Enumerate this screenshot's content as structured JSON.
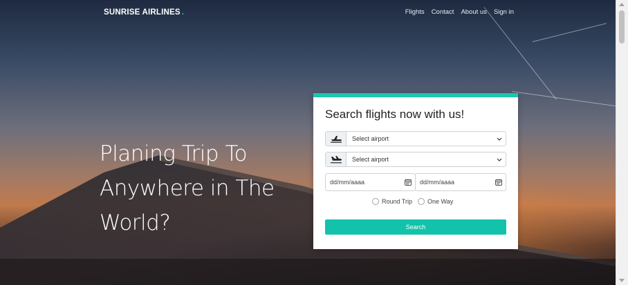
{
  "nav": {
    "brand": "SUNRISE AIRLINES",
    "brand_dot": ".",
    "links": [
      "Flights",
      "Contact",
      "About us",
      "Sign in"
    ]
  },
  "hero": {
    "headline_lines": [
      "Planing Trip To",
      "Anywhere in The",
      "World?"
    ]
  },
  "search_card": {
    "title": "Search flights now with us!",
    "from": {
      "value": "Select airport",
      "icon": "plane-departure-icon"
    },
    "to": {
      "value": "Select airport",
      "icon": "plane-arrival-icon"
    },
    "depart_date": {
      "placeholder": "dd/mm/aaaa"
    },
    "return_date": {
      "placeholder": "dd/mm/aaaa"
    },
    "trip_types": [
      "Round Trip",
      "One Way"
    ],
    "search_label": "Search"
  },
  "colors": {
    "accent": "#1bc6b0",
    "button": "#13c2aa"
  }
}
